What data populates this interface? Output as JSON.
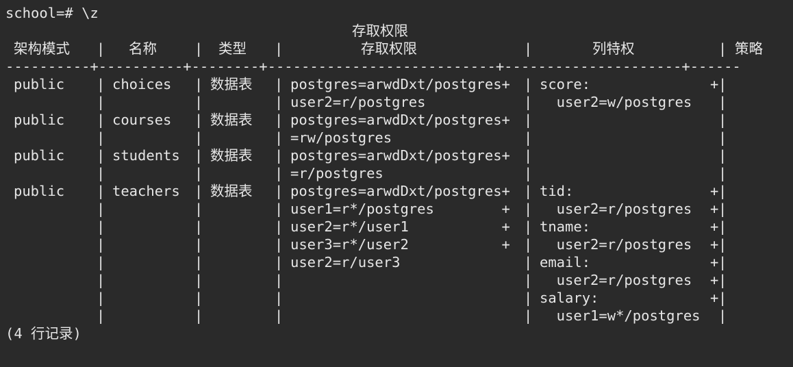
{
  "terminal": {
    "command_line": "school=# \\z",
    "title_line": "存取权限",
    "headers": {
      "schema": "架构模式",
      "name": "名称",
      "type": "类型",
      "access": "存取权限",
      "column_privs": "列特权",
      "policies": "策略"
    },
    "divider": "----------+----------+--------+-----------------------------+----------------------+------",
    "rows": [
      {
        "schema": "public",
        "name": "choices",
        "type": "数据表",
        "access": "postgres=arwdDxt/postgres+",
        "cols": "score:",
        "cols_plus": "+"
      },
      {
        "schema": "",
        "name": "",
        "type": "",
        "access": "user2=r/postgres",
        "cols": "  user2=w/postgres",
        "cols_plus": ""
      },
      {
        "schema": "public",
        "name": "courses",
        "type": "数据表",
        "access": "postgres=arwdDxt/postgres+",
        "cols": "",
        "cols_plus": ""
      },
      {
        "schema": "",
        "name": "",
        "type": "",
        "access": "=rw/postgres",
        "cols": "",
        "cols_plus": ""
      },
      {
        "schema": "public",
        "name": "students",
        "type": "数据表",
        "access": "postgres=arwdDxt/postgres+",
        "cols": "",
        "cols_plus": ""
      },
      {
        "schema": "",
        "name": "",
        "type": "",
        "access": "=r/postgres",
        "cols": "",
        "cols_plus": ""
      },
      {
        "schema": "public",
        "name": "teachers",
        "type": "数据表",
        "access": "postgres=arwdDxt/postgres+",
        "cols": "tid:",
        "cols_plus": "+"
      },
      {
        "schema": "",
        "name": "",
        "type": "",
        "access": "user1=r*/postgres        +",
        "cols": "  user2=r/postgres",
        "cols_plus": "+"
      },
      {
        "schema": "",
        "name": "",
        "type": "",
        "access": "user2=r*/user1           +",
        "cols": "tname:",
        "cols_plus": "+"
      },
      {
        "schema": "",
        "name": "",
        "type": "",
        "access": "user3=r*/user2           +",
        "cols": "  user2=r/postgres",
        "cols_plus": "+"
      },
      {
        "schema": "",
        "name": "",
        "type": "",
        "access": "user2=r/user3",
        "cols": "email:",
        "cols_plus": "+"
      },
      {
        "schema": "",
        "name": "",
        "type": "",
        "access": "",
        "cols": "  user2=r/postgres",
        "cols_plus": "+"
      },
      {
        "schema": "",
        "name": "",
        "type": "",
        "access": "",
        "cols": "salary:",
        "cols_plus": "+"
      },
      {
        "schema": "",
        "name": "",
        "type": "",
        "access": "",
        "cols": "  user1=w*/postgres",
        "cols_plus": ""
      }
    ],
    "footer": "(4 行记录)"
  }
}
